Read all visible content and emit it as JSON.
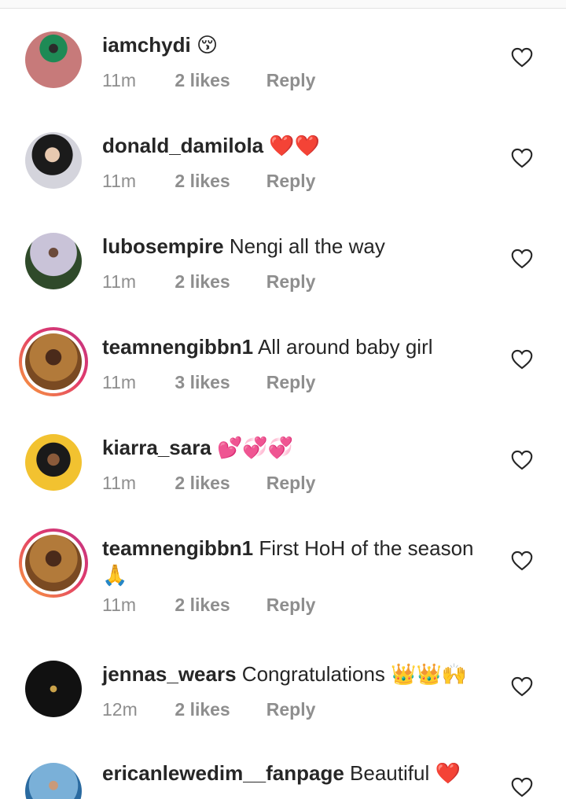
{
  "comments": [
    {
      "username": "iamchydi",
      "text": "😚",
      "time": "11m",
      "likes": "2 likes",
      "reply": "Reply"
    },
    {
      "username": "donald_damilola",
      "text": "❤️❤️",
      "time": "11m",
      "likes": "2 likes",
      "reply": "Reply"
    },
    {
      "username": "lubosempire",
      "text": "Nengi all the way",
      "time": "11m",
      "likes": "2 likes",
      "reply": "Reply"
    },
    {
      "username": "teamnengibbn1",
      "text": "All around baby girl",
      "time": "11m",
      "likes": "3 likes",
      "reply": "Reply"
    },
    {
      "username": "kiarra_sara",
      "text": "💕💞💞",
      "time": "11m",
      "likes": "2 likes",
      "reply": "Reply"
    },
    {
      "username": "teamnengibbn1",
      "text": "First HoH of the season",
      "text2": "🙏",
      "time": "11m",
      "likes": "2 likes",
      "reply": "Reply"
    },
    {
      "username": "jennas_wears",
      "text": "Congratulations 👑👑🙌",
      "time": "12m",
      "likes": "2 likes",
      "reply": "Reply"
    },
    {
      "username": "ericanlewedim__fanpage",
      "text": "Beautiful ❤️"
    }
  ],
  "icons": {
    "like": "heart-outline-icon"
  },
  "colors": {
    "text": "#262626",
    "meta": "#8e8e8e",
    "story_ring_start": "#f9a23a",
    "story_ring_end": "#c13584"
  }
}
